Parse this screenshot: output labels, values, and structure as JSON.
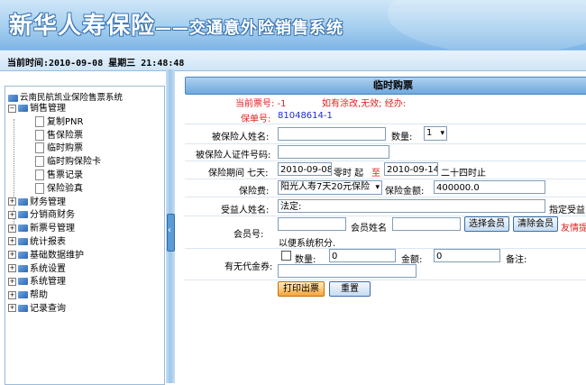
{
  "header": {
    "title": "新华人寿保险",
    "subtitle": "——交通意外险销售系统"
  },
  "timebar": {
    "text": "当前时间:2010-09-08 星期三 21:48:48"
  },
  "sidebar": {
    "root": "云南民航凯业保险售票系统",
    "group_open": "销售管理",
    "children": [
      "复制PNR",
      "售保险票",
      "临时购票",
      "临时购保险卡",
      "售票记录",
      "保险验真"
    ],
    "groups": [
      "财务管理",
      "分销商财务",
      "新票号管理",
      "统计报表",
      "基础数据维护",
      "系统设置",
      "系统管理",
      "帮助",
      "记录查询"
    ]
  },
  "panel": {
    "title": "临时购票",
    "current_ticket_label": "当前票号: -1",
    "warning": "如有涂改,无效; 经办:",
    "policy_label": "保单号:",
    "policy_no": "81048614-1",
    "insured_name_label": "被保险人姓名:",
    "quantity_label": "数量:",
    "quantity_value": "1",
    "insured_id_label": "被保险人证件号码:",
    "period_label": "保险期间 七天:",
    "start_date": "2010-09-08",
    "start_suffix": "零时 起",
    "to_label": "至",
    "end_date": "2010-09-14",
    "end_suffix": "二十四时止",
    "premium_label": "保险费:",
    "premium_option": "阳光人寿7天20元保险",
    "amount_label": "保险金额:",
    "amount_value": "400000.0",
    "beneficiary_label": "受益人姓名:",
    "beneficiary_value": "法定:",
    "beneficiary_note": "指定受益",
    "member_no_label": "会员号:",
    "member_name_label": "会员姓名",
    "select_member_btn": "选择会员",
    "clear_member_btn": "清除会员",
    "member_hint": "友情提",
    "member_note": "以便系统积分.",
    "voucher_label": "有无代金券:",
    "voucher_qty_label": "数量:",
    "voucher_qty_value": "0",
    "voucher_amount_label": "金额:",
    "voucher_amount_value": "0",
    "remark_label": "备注:",
    "print_btn": "打印出票",
    "reset_btn": "重置"
  }
}
